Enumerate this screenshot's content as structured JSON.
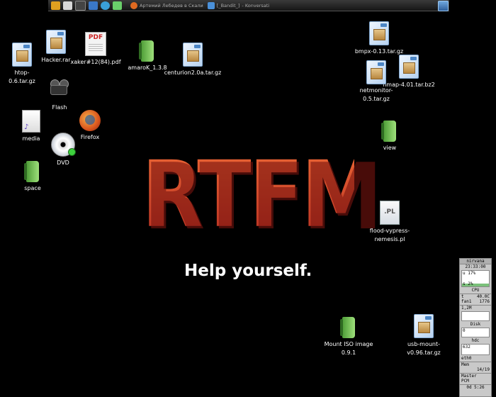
{
  "taskbar": {
    "launchers": [
      {
        "icon": "gear-icon",
        "color": "#e0a020"
      },
      {
        "icon": "home-icon",
        "color": "#d8d8d8"
      },
      {
        "icon": "terminal-icon",
        "color": "#444444"
      },
      {
        "icon": "browser-icon",
        "color": "#3a78c8"
      },
      {
        "icon": "globe-icon",
        "color": "#3aa0d8"
      },
      {
        "icon": "editor-icon",
        "color": "#6ad06a"
      }
    ],
    "tasks": [
      {
        "label": "Артемий Лебедев в Скали",
        "icon": "firefox-icon",
        "color": "#e06a20"
      },
      {
        "label": "[_Bandit_]",
        "icon": "app-icon",
        "color": "#4a90d9"
      },
      {
        "label": "- Konversati",
        "icon": "",
        "color": ""
      }
    ],
    "tray": [
      "EN"
    ]
  },
  "desktop": {
    "icons": [
      {
        "label": "htop-0.6.tar.gz",
        "type": "package"
      },
      {
        "label": "Hacker.rar",
        "type": "package"
      },
      {
        "label": "xaker#12(84).pdf",
        "type": "pdf"
      },
      {
        "label": "amaroK_1.3.8",
        "type": "folder"
      },
      {
        "label": "centurion2.0a.tar.gz",
        "type": "package"
      },
      {
        "label": "Flash",
        "type": "camera"
      },
      {
        "label": "media",
        "type": "media"
      },
      {
        "label": "Firefox",
        "type": "firefox"
      },
      {
        "label": "DVD",
        "type": "dvd"
      },
      {
        "label": "space",
        "type": "folder"
      },
      {
        "label": "bmpx-0.13.tar.gz",
        "type": "package"
      },
      {
        "label": "nmap-4.01.tar.bz2",
        "type": "package"
      },
      {
        "label": "netmonitor-0.5.tar.gz",
        "type": "package"
      },
      {
        "label": "view",
        "type": "folder"
      },
      {
        "label": "flood-vypress-nemesis.pl",
        "type": "perl"
      },
      {
        "label": "Mount ISO image 0.9.1",
        "type": "folder"
      },
      {
        "label": "usb-mount-v0.96.tar.gz",
        "type": "package"
      }
    ]
  },
  "wallpaper": {
    "logo": "RTFM",
    "tagline": "Help yourself.",
    "logo_color": "#d34c2a"
  },
  "monitor": {
    "host": "nirvana",
    "time": "23:33:00",
    "cpu_user": "u 17%",
    "cpu_sys": "s 2%",
    "cpu_label": "CPU",
    "temp_label": "t",
    "temp_value": "40.0C",
    "fan_label": "fan1",
    "fan_value": "1776",
    "net_value": "1,2M",
    "disk_label": "Disk",
    "disk_value": "0",
    "hdc_label": "hdc",
    "hdc_value": "632",
    "eth_label": "eth0",
    "mem_label": "Mem",
    "mem_value": "14/19",
    "master_label": "Master",
    "pcm_label": "PCM",
    "uptime": "0d 5:26",
    "cpu_level": 0.19
  }
}
